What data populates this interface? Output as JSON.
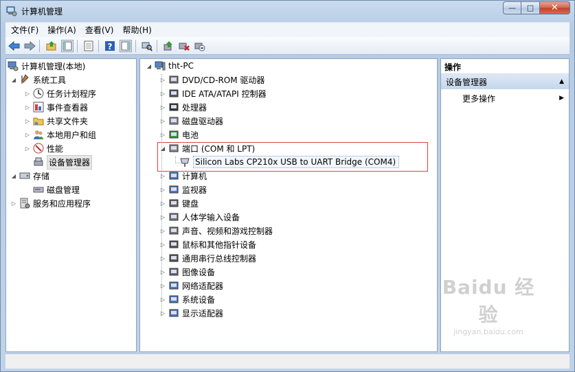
{
  "window": {
    "title": "计算机管理",
    "controls": {
      "minimize": "—",
      "maximize": "□",
      "close": "✕"
    }
  },
  "menubar": [
    {
      "label": "文件(F)"
    },
    {
      "label": "操作(A)"
    },
    {
      "label": "查看(V)"
    },
    {
      "label": "帮助(H)"
    }
  ],
  "toolbar": {
    "icons": [
      "back-arrow-icon",
      "forward-arrow-icon",
      "up-folder-icon",
      "show-hide-tree-icon",
      "export-list-icon",
      "help-icon",
      "show-action-pane-icon",
      "scan-hardware-icon",
      "update-driver-icon",
      "uninstall-icon",
      "disable-device-icon"
    ]
  },
  "tree": {
    "root": "计算机管理(本地)",
    "system_tools": "系统工具",
    "task_scheduler": "任务计划程序",
    "event_viewer": "事件查看器",
    "shared_folders": "共享文件夹",
    "local_users": "本地用户和组",
    "performance": "性能",
    "device_manager": "设备管理器",
    "storage": "存储",
    "disk_management": "磁盘管理",
    "services_apps": "服务和应用程序"
  },
  "devices": {
    "computer_name": "tht-PC",
    "categories": [
      "DVD/CD-ROM 驱动器",
      "IDE ATA/ATAPI 控制器",
      "处理器",
      "磁盘驱动器",
      "电池",
      "端口 (COM 和 LPT)",
      "计算机",
      "监视器",
      "键盘",
      "人体学输入设备",
      "声音、视频和游戏控制器",
      "鼠标和其他指针设备",
      "通用串行总线控制器",
      "图像设备",
      "网络适配器",
      "系统设备",
      "显示适配器"
    ],
    "port_device": "Silicon Labs CP210x USB to UART Bridge (COM4)"
  },
  "actions": {
    "header": "操作",
    "section": "设备管理器",
    "more": "更多操作"
  },
  "watermark": {
    "brand": "Baidu 经验",
    "url": "jingyan.baidu.com"
  },
  "colors": {
    "highlight_border": "#e04040",
    "section_bg": "#c5d7ec",
    "window_frame": "#bcd3ea"
  }
}
